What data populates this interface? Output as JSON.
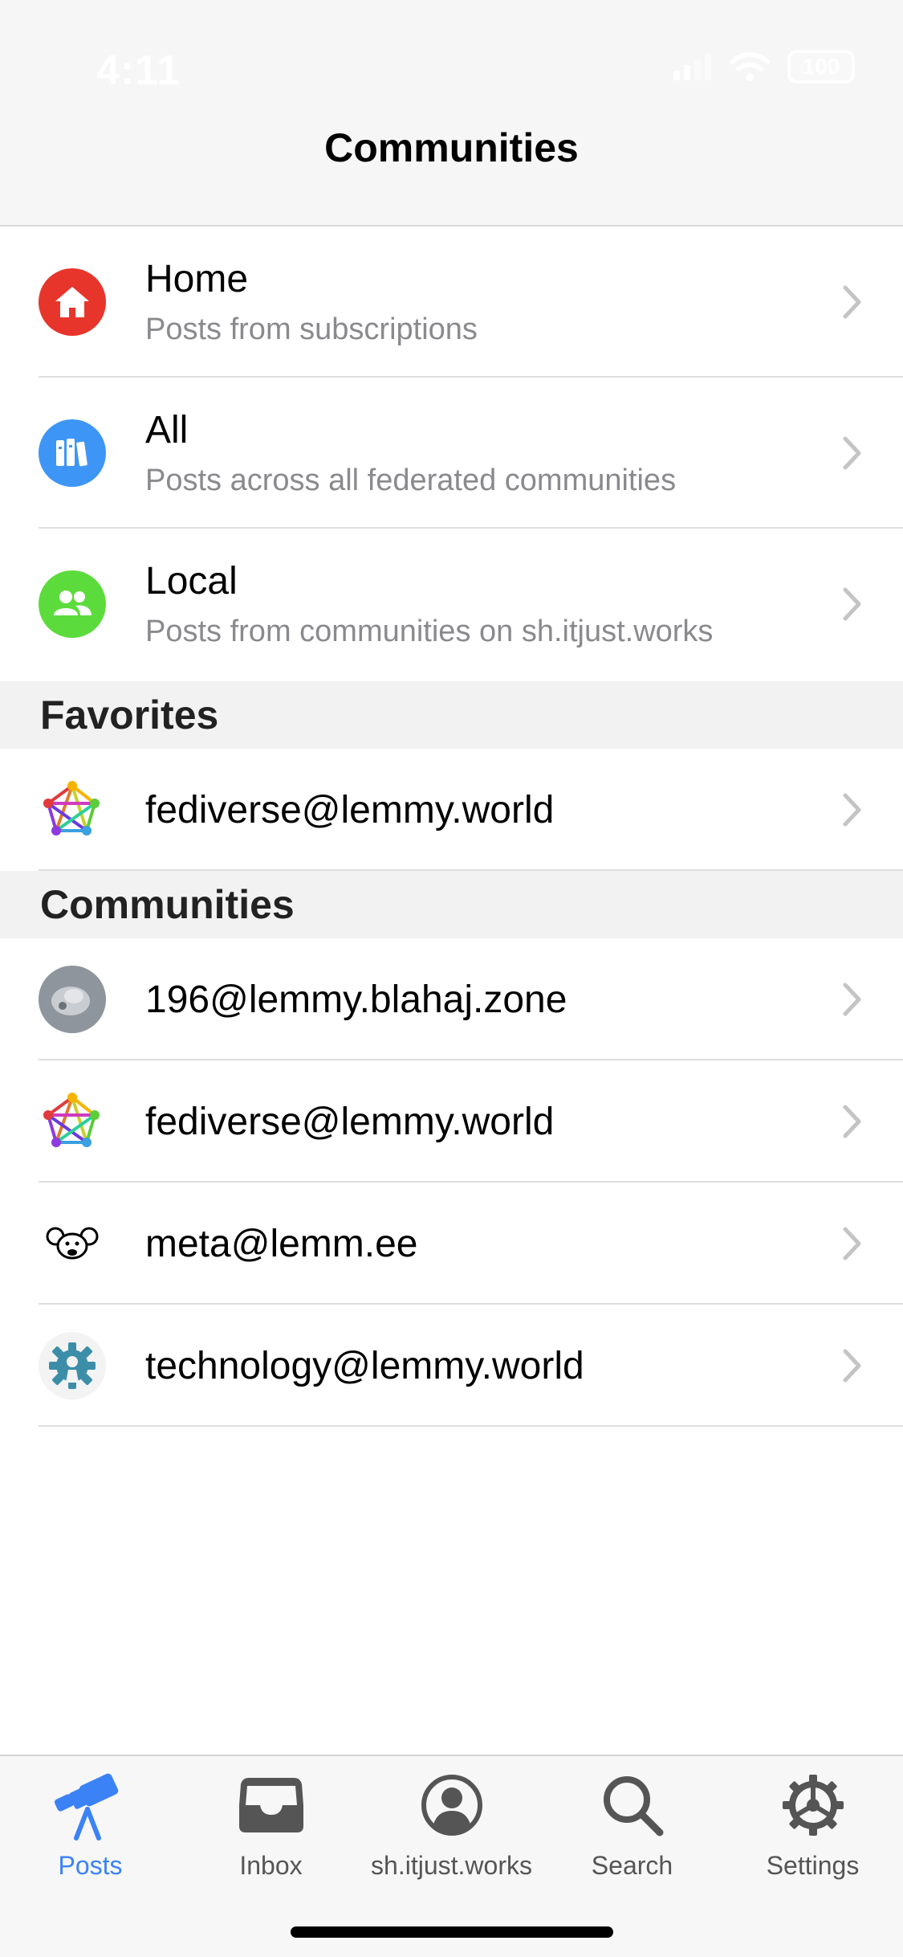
{
  "status_bar": {
    "time": "4:11",
    "battery": "100"
  },
  "nav": {
    "title": "Communities"
  },
  "feeds": [
    {
      "title": "Home",
      "subtitle": "Posts from subscriptions",
      "icon": "house-icon",
      "color": "#e8352b"
    },
    {
      "title": "All",
      "subtitle": "Posts across all federated communities",
      "icon": "books-icon",
      "color": "#3d96f5"
    },
    {
      "title": "Local",
      "subtitle": "Posts from communities on sh.itjust.works",
      "icon": "people-icon",
      "color": "#5cdc3c"
    }
  ],
  "favorites": {
    "header": "Favorites",
    "items": [
      {
        "name": "fediverse@lemmy.world",
        "icon": "fediverse-icon"
      }
    ]
  },
  "communities": {
    "header": "Communities",
    "items": [
      {
        "name": "196@lemmy.blahaj.zone",
        "icon": "community-avatar-icon"
      },
      {
        "name": "fediverse@lemmy.world",
        "icon": "fediverse-icon"
      },
      {
        "name": "meta@lemm.ee",
        "icon": "mouse-icon"
      },
      {
        "name": "technology@lemmy.world",
        "icon": "gear-person-icon"
      }
    ]
  },
  "tabs": [
    {
      "label": "Posts",
      "icon": "telescope-icon",
      "active": true
    },
    {
      "label": "Inbox",
      "icon": "tray-icon",
      "active": false
    },
    {
      "label": "sh.itjust.works",
      "icon": "person-circle-icon",
      "active": false
    },
    {
      "label": "Search",
      "icon": "magnifier-icon",
      "active": false
    },
    {
      "label": "Settings",
      "icon": "gear-icon",
      "active": false
    }
  ],
  "colors": {
    "accent": "#3b82f6",
    "chevron": "#c4c4c6",
    "subtitle": "#8a8a8e"
  }
}
